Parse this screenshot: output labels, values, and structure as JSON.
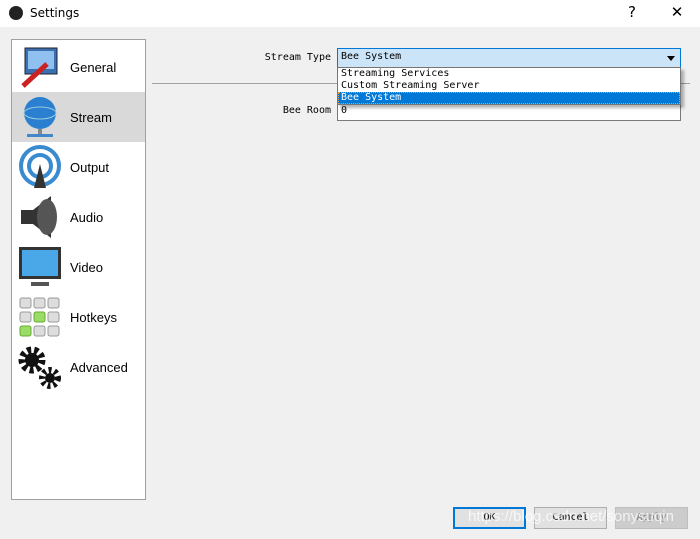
{
  "window": {
    "title": "Settings",
    "help": "?",
    "close": "✕"
  },
  "sidebar": {
    "items": [
      {
        "label": "General",
        "icon": "general-icon"
      },
      {
        "label": "Stream",
        "icon": "stream-globe-icon",
        "selected": true
      },
      {
        "label": "Output",
        "icon": "output-broadcast-icon"
      },
      {
        "label": "Audio",
        "icon": "speaker-icon"
      },
      {
        "label": "Video",
        "icon": "monitor-icon"
      },
      {
        "label": "Hotkeys",
        "icon": "keyboard-icon"
      },
      {
        "label": "Advanced",
        "icon": "gears-icon"
      }
    ]
  },
  "stream": {
    "stream_type_label": "Stream Type",
    "stream_type_value": "Bee System",
    "options": [
      "Streaming Services",
      "Custom Streaming Server",
      "Bee System"
    ],
    "bee_room_label": "Bee Room",
    "bee_room_value": "0"
  },
  "buttons": {
    "ok": "OK",
    "cancel": "Cancel",
    "apply": "Apply"
  },
  "watermark": "https://blog.csdn.net/sonysuqin",
  "colors": {
    "accent": "#0078d7",
    "combo_bg": "#cce4f7"
  }
}
